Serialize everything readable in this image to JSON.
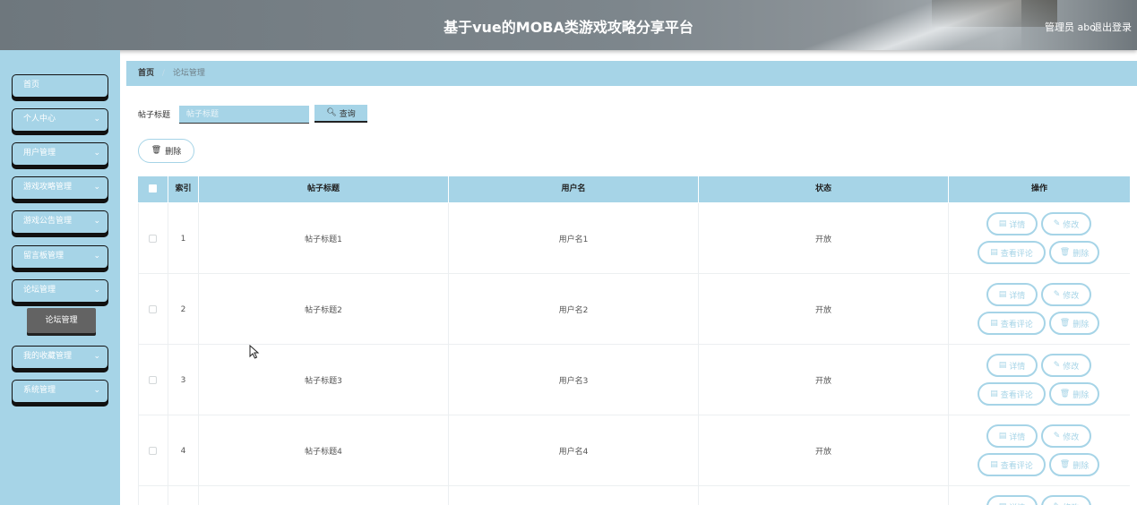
{
  "header": {
    "title": "基于vue的MOBA类游戏攻略分享平台",
    "user": "管理员 abo",
    "logout": "退出登录"
  },
  "sidebar": {
    "items": [
      {
        "label": "首页",
        "has_chevron": false
      },
      {
        "label": "个人中心",
        "has_chevron": true
      },
      {
        "label": "用户管理",
        "has_chevron": true
      },
      {
        "label": "游戏攻略管理",
        "has_chevron": true
      },
      {
        "label": "游戏公告管理",
        "has_chevron": true
      },
      {
        "label": "留言板管理",
        "has_chevron": true
      },
      {
        "label": "论坛管理",
        "has_chevron": true
      },
      {
        "label": "我的收藏管理",
        "has_chevron": true
      },
      {
        "label": "系统管理",
        "has_chevron": true
      }
    ],
    "submenu": {
      "label": "论坛管理"
    }
  },
  "breadcrumb": {
    "home": "首页",
    "separator": "/",
    "current": "论坛管理"
  },
  "search": {
    "label": "帖子标题",
    "placeholder": "帖子标题",
    "value": "",
    "query_label": "查询",
    "query_icon": "search-icon"
  },
  "toolbar": {
    "delete_label": "删除",
    "delete_icon": "trash-icon"
  },
  "table": {
    "columns": [
      "索引",
      "帖子标题",
      "用户名",
      "状态",
      "操作"
    ],
    "rows": [
      {
        "index": "1",
        "title": "帖子标题1",
        "username": "用户名1",
        "status": "开放"
      },
      {
        "index": "2",
        "title": "帖子标题2",
        "username": "用户名2",
        "status": "开放"
      },
      {
        "index": "3",
        "title": "帖子标题3",
        "username": "用户名3",
        "status": "开放"
      },
      {
        "index": "4",
        "title": "帖子标题4",
        "username": "用户名4",
        "status": "开放"
      }
    ],
    "actions": {
      "detail": "详情",
      "edit": "修改",
      "comments": "查看评论",
      "delete": "删除"
    }
  },
  "colors": {
    "accent": "#a6d4e7",
    "header_bg": "#7d868c",
    "submenu_active": "#636363",
    "text": "#333333"
  }
}
